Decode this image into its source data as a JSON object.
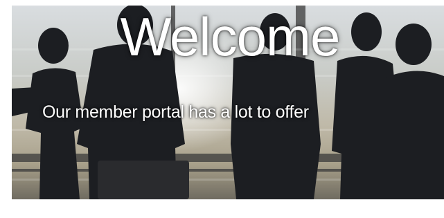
{
  "hero": {
    "heading": "Welcome",
    "tagline": "Our member portal has a lot to offer",
    "background_image": "business-people-silhouettes-office-window",
    "colors": {
      "text": "#ffffff",
      "backdrop_light": "#d9dde0",
      "backdrop_warm": "#bfb9a8",
      "silhouette": "#1c1e22"
    }
  }
}
